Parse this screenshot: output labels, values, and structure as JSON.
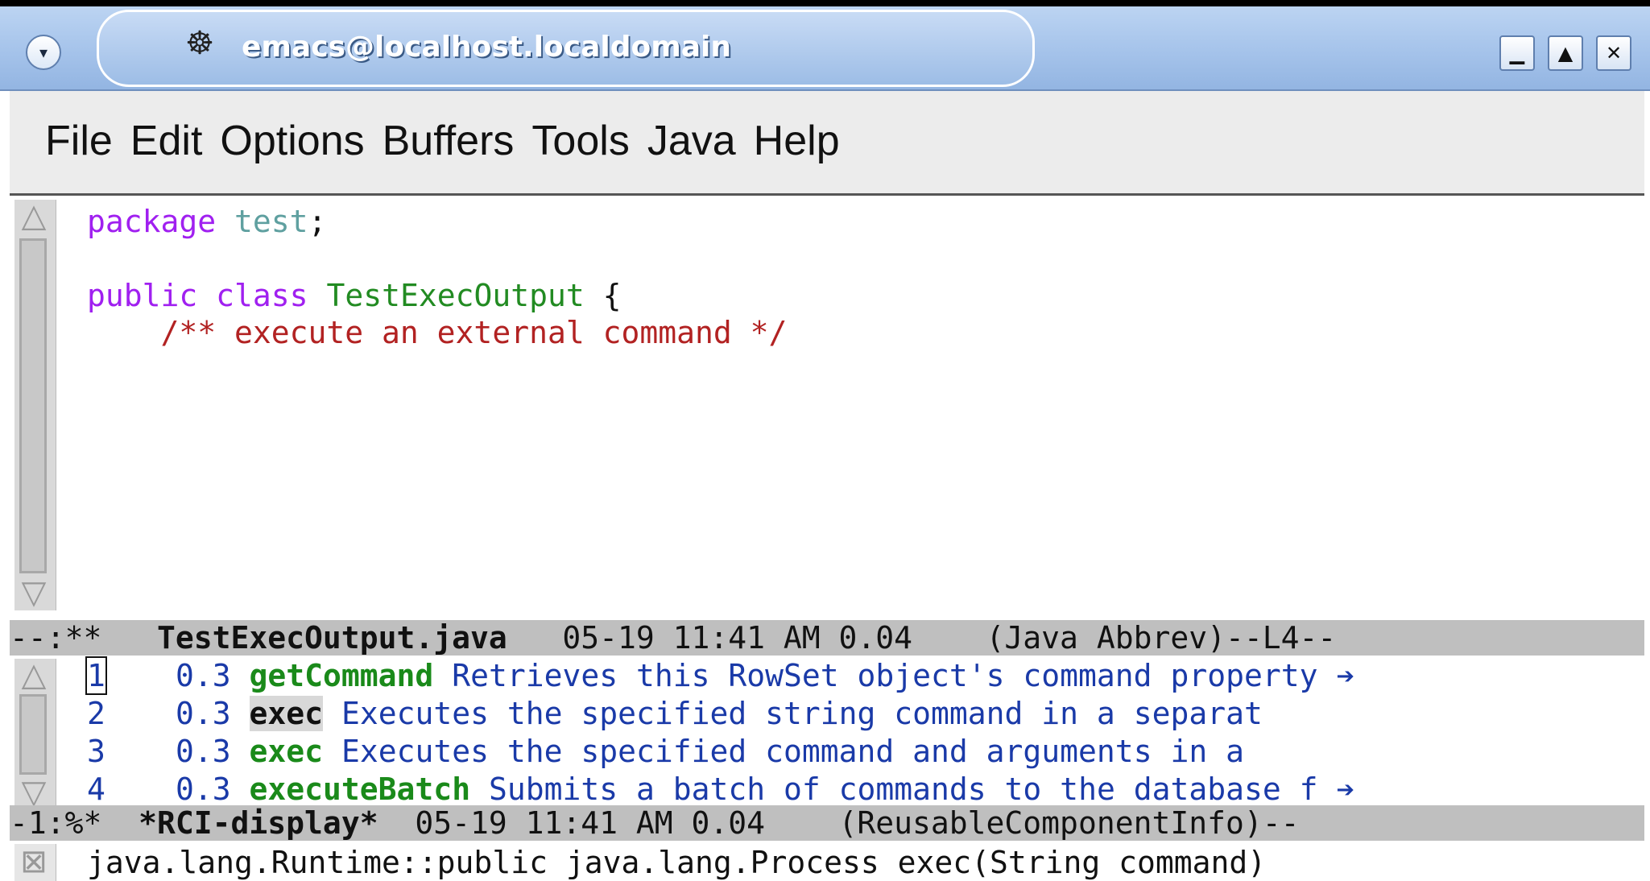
{
  "window": {
    "title": "emacs@localhost.localdomain",
    "buttons": {
      "minimize": "▁",
      "maximize": "▲",
      "close": "✕"
    },
    "menu_icon": "▾"
  },
  "menubar": {
    "items": [
      "File",
      "Edit",
      "Options",
      "Buffers",
      "Tools",
      "Java",
      "Help"
    ]
  },
  "editor": {
    "lines": [
      {
        "parts": [
          {
            "t": "package",
            "c": "kw"
          },
          {
            "t": " "
          },
          {
            "t": "test",
            "c": "pkg"
          },
          {
            "t": ";"
          }
        ]
      },
      {
        "parts": []
      },
      {
        "parts": [
          {
            "t": "public",
            "c": "kw"
          },
          {
            "t": " "
          },
          {
            "t": "class",
            "c": "kw"
          },
          {
            "t": " "
          },
          {
            "t": "TestExecOutput",
            "c": "type"
          },
          {
            "t": " {"
          }
        ]
      },
      {
        "parts": [
          {
            "t": "    /** execute an external command */",
            "c": "comment"
          }
        ]
      }
    ]
  },
  "modeline_main": {
    "flags": "--:**",
    "buffer": "TestExecOutput.java",
    "info": "   05-19 11:41 AM 0.04    (Java Abbrev)--L4--"
  },
  "rci": {
    "rows": [
      {
        "n": "1",
        "score": "0.3",
        "method": "getCommand",
        "desc": "Retrieves this RowSet object's command property",
        "more": "➔",
        "selected": false
      },
      {
        "n": "2",
        "score": "0.3",
        "method": "exec",
        "desc": "Executes the specified string command in a separat",
        "more": "",
        "selected": true
      },
      {
        "n": "3",
        "score": "0.3",
        "method": "exec",
        "desc": "Executes the specified command and arguments in a",
        "more": "",
        "selected": false
      },
      {
        "n": "4",
        "score": "0.3",
        "method": "executeBatch",
        "desc": "Submits a batch of commands to the database f",
        "more": "➔",
        "selected": false
      }
    ]
  },
  "modeline_rci": {
    "flags": "-1:%*",
    "buffer": "*RCI-display*",
    "info": "  05-19 11:41 AM 0.04    (ReusableComponentInfo)--"
  },
  "echo_area": {
    "text": "java.lang.Runtime::public java.lang.Process exec(String command)"
  },
  "icons": {
    "scroll_up": "triangle-up-icon",
    "scroll_down": "triangle-down-icon",
    "app": "gnu-icon"
  }
}
